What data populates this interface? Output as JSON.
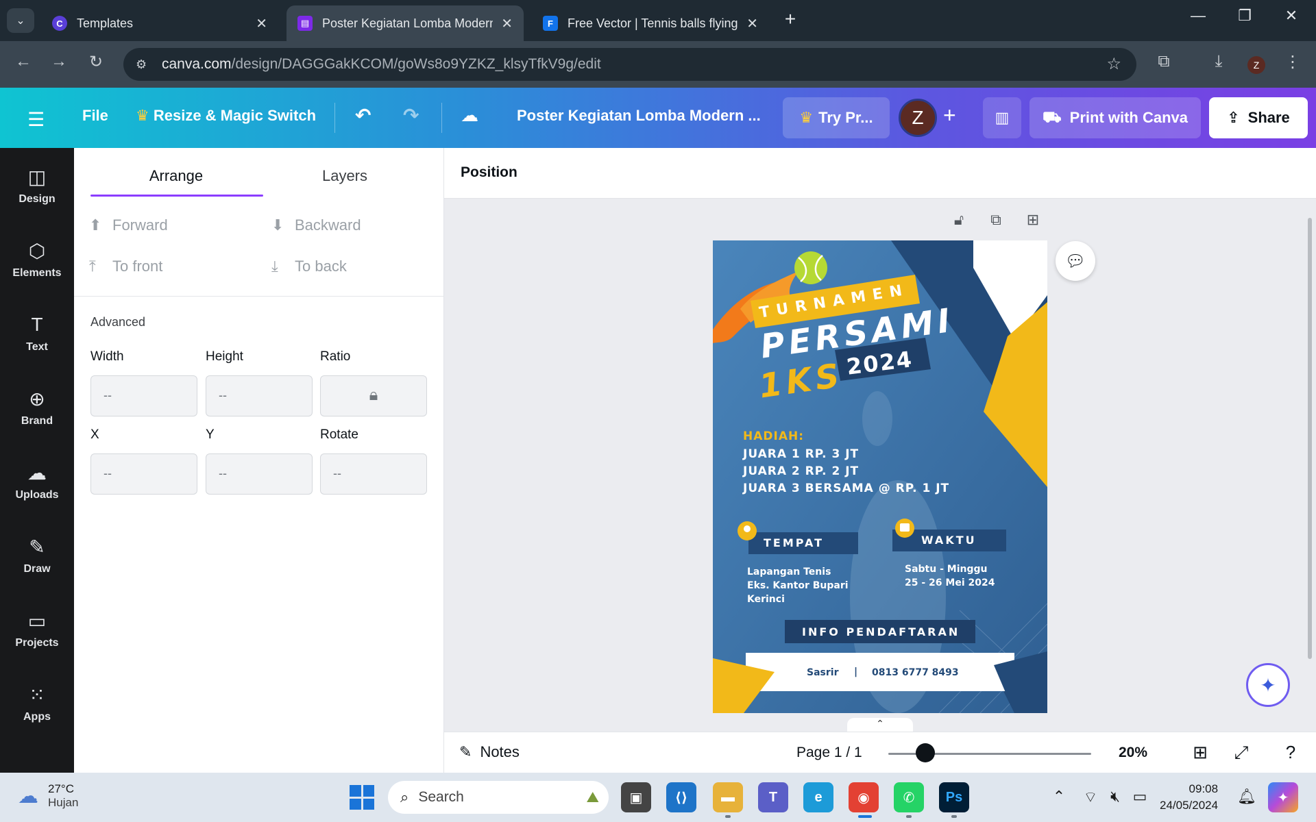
{
  "browser": {
    "tabs": [
      {
        "title": "Templates",
        "favicon": "canva-icon",
        "color": "#5a3fd8"
      },
      {
        "title": "Poster Kegiatan Lomba Modern",
        "favicon": "canva-doc-icon",
        "color": "#7d2ae8"
      },
      {
        "title": "Free Vector | Tennis balls flying",
        "favicon": "freepik-icon",
        "color": "#1273eb"
      }
    ],
    "url_domain": "canva.com",
    "url_path": "/design/DAGGGakKCOM/goWs8o9YZKZ_klsyTfkV9g/edit",
    "profile_initial": "Z"
  },
  "canva": {
    "file_label": "File",
    "resize_label": "Resize & Magic Switch",
    "design_title": "Poster Kegiatan Lomba Modern ...",
    "try_pro_label": "Try Pr...",
    "avatar_initial": "Z",
    "print_label": "Print with Canva",
    "share_label": "Share"
  },
  "rail": [
    {
      "label": "Design",
      "icon": "design-icon"
    },
    {
      "label": "Elements",
      "icon": "elements-icon"
    },
    {
      "label": "Text",
      "icon": "text-icon"
    },
    {
      "label": "Brand",
      "icon": "brand-icon"
    },
    {
      "label": "Uploads",
      "icon": "uploads-icon"
    },
    {
      "label": "Draw",
      "icon": "draw-icon"
    },
    {
      "label": "Projects",
      "icon": "projects-icon"
    },
    {
      "label": "Apps",
      "icon": "apps-icon"
    }
  ],
  "panel": {
    "tabs": [
      "Arrange",
      "Layers"
    ],
    "active_tab": "Arrange",
    "forward": "Forward",
    "backward": "Backward",
    "to_front": "To front",
    "to_back": "To back",
    "advanced": "Advanced",
    "width_label": "Width",
    "height_label": "Height",
    "ratio_label": "Ratio",
    "x_label": "X",
    "y_label": "Y",
    "rotate_label": "Rotate",
    "empty_value": "--"
  },
  "toolbar": {
    "position_label": "Position"
  },
  "poster": {
    "turnamen": "TURNAMEN",
    "persami": "PERSAMI",
    "iks": "1KS",
    "year": "2024",
    "hadiah_label": "HADIAH:",
    "prizes": [
      "JUARA 1 RP. 3 JT",
      "JUARA 2 RP. 2 JT",
      "JUARA 3 BERSAMA @ RP. 1 JT"
    ],
    "tempat_label": "TEMPAT",
    "tempat_lines": [
      "Lapangan Tenis",
      "Eks. Kantor Bupari",
      "Kerinci"
    ],
    "waktu_label": "WAKTU",
    "waktu_lines": [
      "Sabtu - Minggu",
      "25 - 26 Mei 2024"
    ],
    "info_label": "INFO PENDAFTARAN",
    "contact_name": "Sasrir",
    "contact_sep": "|",
    "contact_phone": "0813 6777 8493",
    "colors": {
      "blue": "#3f77ad",
      "navy": "#234a78",
      "yellow": "#f2b919",
      "orange": "#f27a1a"
    }
  },
  "bottom": {
    "notes_label": "Notes",
    "page_indicator": "Page 1 / 1",
    "zoom": "20%",
    "zoom_fraction": 0.2
  },
  "taskbar": {
    "temp": "27°C",
    "weather": "Hujan",
    "search_label": "Search",
    "time": "09:08",
    "date": "24/05/2024"
  }
}
